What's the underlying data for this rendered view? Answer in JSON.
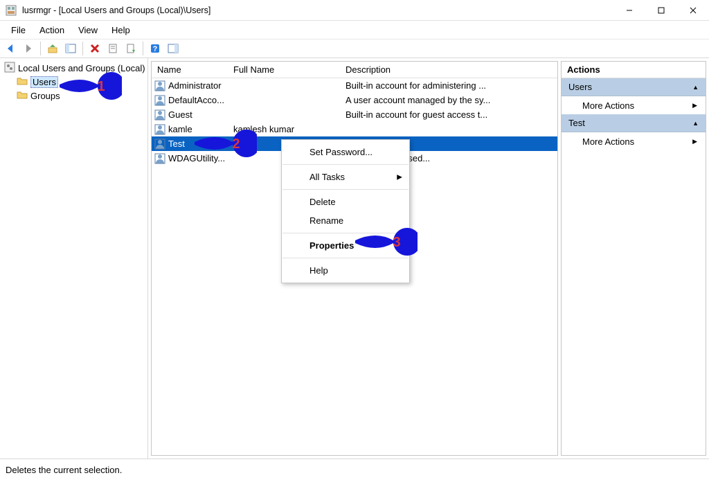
{
  "window": {
    "title": "lusrmgr - [Local Users and Groups (Local)\\Users]"
  },
  "menu": {
    "file": "File",
    "action": "Action",
    "view": "View",
    "help": "Help"
  },
  "tree": {
    "root": "Local Users and Groups (Local)",
    "users": "Users",
    "groups": "Groups"
  },
  "columns": {
    "name": "Name",
    "fullname": "Full Name",
    "description": "Description"
  },
  "users": [
    {
      "name": "Administrator",
      "fullname": "",
      "desc": "Built-in account for administering ..."
    },
    {
      "name": "DefaultAcco...",
      "fullname": "",
      "desc": "A user account managed by the sy..."
    },
    {
      "name": "Guest",
      "fullname": "",
      "desc": "Built-in account for guest access t..."
    },
    {
      "name": "kamle",
      "fullname": "kamlesh kumar",
      "desc": ""
    },
    {
      "name": "Test",
      "fullname": "",
      "desc": ""
    },
    {
      "name": "WDAGUtility...",
      "fullname": "",
      "desc": "managed and used..."
    }
  ],
  "context": {
    "set_password": "Set Password...",
    "all_tasks": "All Tasks",
    "delete": "Delete",
    "rename": "Rename",
    "properties": "Properties",
    "help": "Help"
  },
  "actions": {
    "header": "Actions",
    "section_users": "Users",
    "more_actions": "More Actions",
    "section_test": "Test"
  },
  "status": "Deletes the current selection.",
  "annotations": [
    "1",
    "2",
    "3"
  ]
}
